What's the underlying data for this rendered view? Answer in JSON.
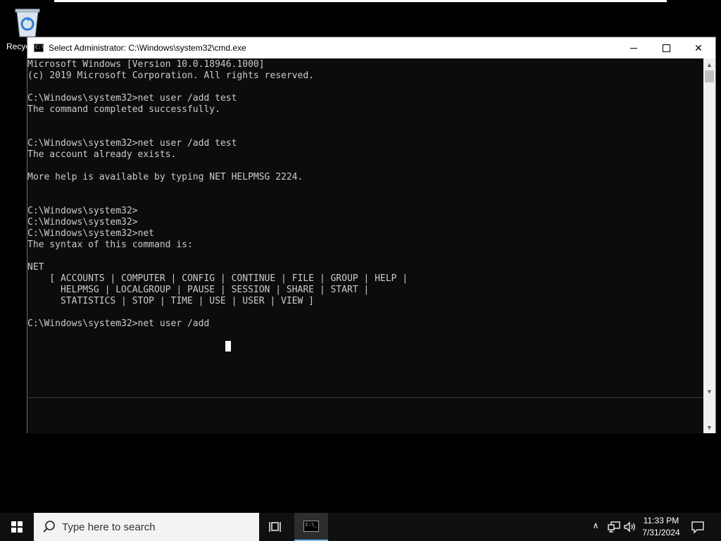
{
  "desktop": {
    "recycle_bin_label": "Recyc"
  },
  "window": {
    "title": "Select Administrator: C:\\Windows\\system32\\cmd.exe",
    "icon_text": "C:\\",
    "close_glyph": "✕"
  },
  "console": {
    "text": "Microsoft Windows [Version 10.0.18946.1000]\n(c) 2019 Microsoft Corporation. All rights reserved.\n\nC:\\Windows\\system32>net user /add test\nThe command completed successfully.\n\n\nC:\\Windows\\system32>net user /add test\nThe account already exists.\n\nMore help is available by typing NET HELPMSG 2224.\n\n\nC:\\Windows\\system32>\nC:\\Windows\\system32>\nC:\\Windows\\system32>net\nThe syntax of this command is:\n\nNET\n    [ ACCOUNTS | COMPUTER | CONFIG | CONTINUE | FILE | GROUP | HELP |\n      HELPMSG | LOCALGROUP | PAUSE | SESSION | SHARE | START |\n      STATISTICS | STOP | TIME | USE | USER | VIEW ]\n\nC:\\Windows\\system32>net user /add"
  },
  "scrollbar": {
    "up_glyph": "▲",
    "down_glyph": "▼"
  },
  "taskbar": {
    "search_placeholder": "Type here to search",
    "cmd_icon_text": "C:\\_",
    "tray_up_glyph": "∧",
    "time": "11:33 PM",
    "date": "7/31/2024"
  }
}
